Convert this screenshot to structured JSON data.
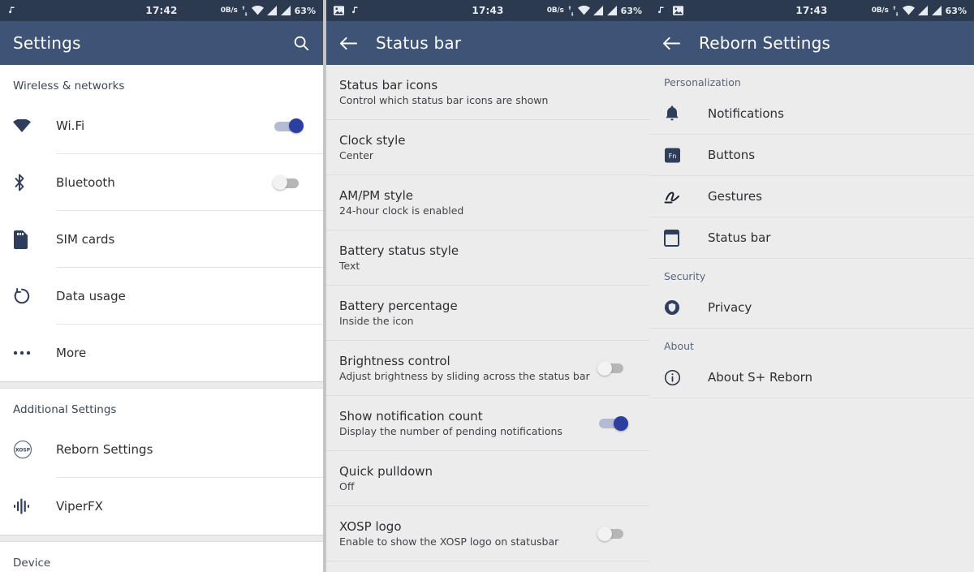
{
  "theme": {
    "statusbar_bg": "#2c3a50",
    "appbar_bg": "#3f5376",
    "panel1_bg": "#ffffff",
    "panel_bg": "#ececec",
    "accent_on": "#2b3fa0",
    "text_primary": "#2d2f33",
    "text_secondary": "#3f4349",
    "category_color": "#59647c"
  },
  "panel1": {
    "statusbar": {
      "icons": [
        "music-note-icon"
      ],
      "time": "17:42",
      "net_rate": "0B/s",
      "rate_icons": [
        "upload-arrow-icon",
        "download-arrow-icon"
      ],
      "signal_icons": [
        "wifi-icon",
        "signal-bars-icon",
        "signal-bars-icon"
      ],
      "battery": "63%"
    },
    "appbar": {
      "title": "Settings",
      "search_icon": "search-icon"
    },
    "sections": [
      {
        "header": "Wireless & networks",
        "rows": [
          {
            "icon": "wifi-icon",
            "label": "Wi.Fi",
            "toggle": "on"
          },
          {
            "icon": "bluetooth-icon",
            "label": "Bluetooth",
            "toggle": "off"
          },
          {
            "icon": "sim-card-icon",
            "label": "SIM cards",
            "toggle": null
          },
          {
            "icon": "data-usage-icon",
            "label": "Data usage",
            "toggle": null
          },
          {
            "icon": "more-dots-icon",
            "label": "More",
            "toggle": null
          }
        ]
      },
      {
        "header": "Additional Settings",
        "rows": [
          {
            "icon": "xosp-logo-icon",
            "label": "Reborn Settings",
            "toggle": null
          },
          {
            "icon": "viperfx-icon",
            "label": "ViperFX",
            "toggle": null
          }
        ]
      },
      {
        "header": "Device",
        "rows": []
      }
    ]
  },
  "panel2": {
    "statusbar": {
      "icons": [
        "image-icon",
        "music-note-icon"
      ],
      "time": "17:43",
      "net_rate": "0B/s",
      "battery": "63%"
    },
    "appbar": {
      "back_icon": "back-arrow-icon",
      "title": "Status bar"
    },
    "prefs": [
      {
        "title": "Status bar icons",
        "summary": "Control which status bar icons are shown",
        "toggle": null
      },
      {
        "title": "Clock style",
        "summary": "Center",
        "toggle": null
      },
      {
        "title": "AM/PM style",
        "summary": "24-hour clock is enabled",
        "toggle": null
      },
      {
        "title": "Battery status style",
        "summary": "Text",
        "toggle": null
      },
      {
        "title": "Battery percentage",
        "summary": "Inside the icon",
        "toggle": null
      },
      {
        "title": "Brightness control",
        "summary": "Adjust brightness by sliding across the status bar",
        "toggle": "off"
      },
      {
        "title": "Show notification count",
        "summary": "Display the number of pending notifications",
        "toggle": "on"
      },
      {
        "title": "Quick pulldown",
        "summary": "Off",
        "toggle": null
      },
      {
        "title": "XOSP logo",
        "summary": "Enable to show the XOSP logo on statusbar",
        "toggle": "off"
      }
    ]
  },
  "panel3": {
    "statusbar": {
      "icons": [
        "music-note-icon",
        "image-icon"
      ],
      "time": "17:43",
      "net_rate": "0B/s",
      "battery": "63%"
    },
    "appbar": {
      "back_icon": "back-arrow-icon",
      "title": "Reborn Settings"
    },
    "groups": [
      {
        "category": "Personalization",
        "rows": [
          {
            "icon": "bell-icon",
            "label": "Notifications"
          },
          {
            "icon": "fn-key-icon",
            "label": "Buttons"
          },
          {
            "icon": "gesture-icon",
            "label": "Gestures"
          },
          {
            "icon": "status-bar-icon",
            "label": "Status bar"
          }
        ]
      },
      {
        "category": "Security",
        "rows": [
          {
            "icon": "privacy-shield-icon",
            "label": "Privacy"
          }
        ]
      },
      {
        "category": "About",
        "rows": [
          {
            "icon": "info-icon",
            "label": "About S+ Reborn"
          }
        ]
      }
    ]
  }
}
